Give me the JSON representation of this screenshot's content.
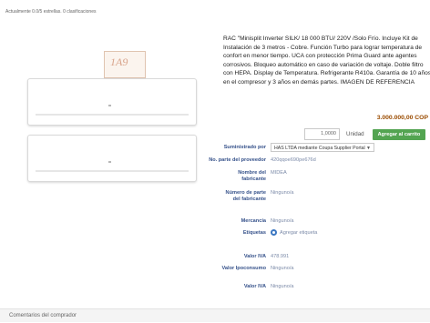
{
  "rating_text": "Actualmente 0.0/5 estrellas. 0 clasificaciones",
  "product": {
    "box_logo": "1A9",
    "description": "RAC \"Minisplit Inverter SILK/ 18 000 BTU/ 220V /Solo Frío. Incluye Kit de Instalación de 3 metros - Cobre. Función Turbo para lograr temperatura de confort en menor tiempo. UCA con protección Prima Guard ante agentes corrosivos. Bloqueo automático en caso de variación de voltaje. Doble filtro con HEPA. Display de Temperatura. Refrigerante R410a. Garantía de 10 años en el compresor y 3 años en demás partes. IMAGEN DE REFERENCIA",
    "price": "3.000.000,00 COP",
    "quantity": "1,0000",
    "unit_label": "Unidad",
    "add_button": "Agregar al carrito"
  },
  "details": {
    "supplied_by_label": "Suministrado por",
    "supplied_by_value": "HAS LTDA mediante Coupa Supplier Portal",
    "part_no_label": "No. parte del proveedor",
    "part_no_value": "420qqoe690pe676d",
    "manufacturer_label": "Nombre del fabricante",
    "manufacturer_value": "MIDEA",
    "mfr_part_label": "Número de parte del fabricante",
    "mfr_part_value": "Ninguno/a",
    "brand_label": "Mercancía",
    "brand_value": "Ninguno/a",
    "tags_label": "Etiquetas",
    "tags_value": "Agregar etiqueta",
    "iva_label": "Valor IVA",
    "iva_value": "478.991",
    "ipoconsumo_label": "Valor Ipoconsumo",
    "ipoconsumo_value": "Ninguno/a",
    "iva2_label": "Valor IVA",
    "iva2_value": "Ninguno/a"
  },
  "comments_label": "Comentarios del comprador"
}
